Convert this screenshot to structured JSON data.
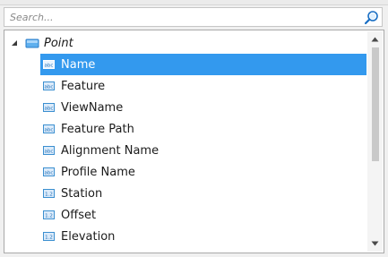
{
  "search": {
    "placeholder": "Search...",
    "value": ""
  },
  "tree": {
    "root": {
      "label": "Point",
      "icon": "folder-icon",
      "expanded": true
    },
    "items": [
      {
        "label": "Name",
        "icon": "text-field-icon",
        "selected": true
      },
      {
        "label": "Feature",
        "icon": "text-field-icon"
      },
      {
        "label": "ViewName",
        "icon": "text-field-icon"
      },
      {
        "label": "Feature Path",
        "icon": "text-field-icon"
      },
      {
        "label": "Alignment Name",
        "icon": "text-field-icon"
      },
      {
        "label": "Profile Name",
        "icon": "text-field-icon"
      },
      {
        "label": "Station",
        "icon": "numeric-field-icon"
      },
      {
        "label": "Offset",
        "icon": "numeric-field-icon"
      },
      {
        "label": "Elevation",
        "icon": "numeric-field-icon"
      }
    ]
  },
  "colors": {
    "selection": "#3399ee",
    "folder_icon": "#3a8fd9",
    "field_icon": "#3b8fd0"
  }
}
